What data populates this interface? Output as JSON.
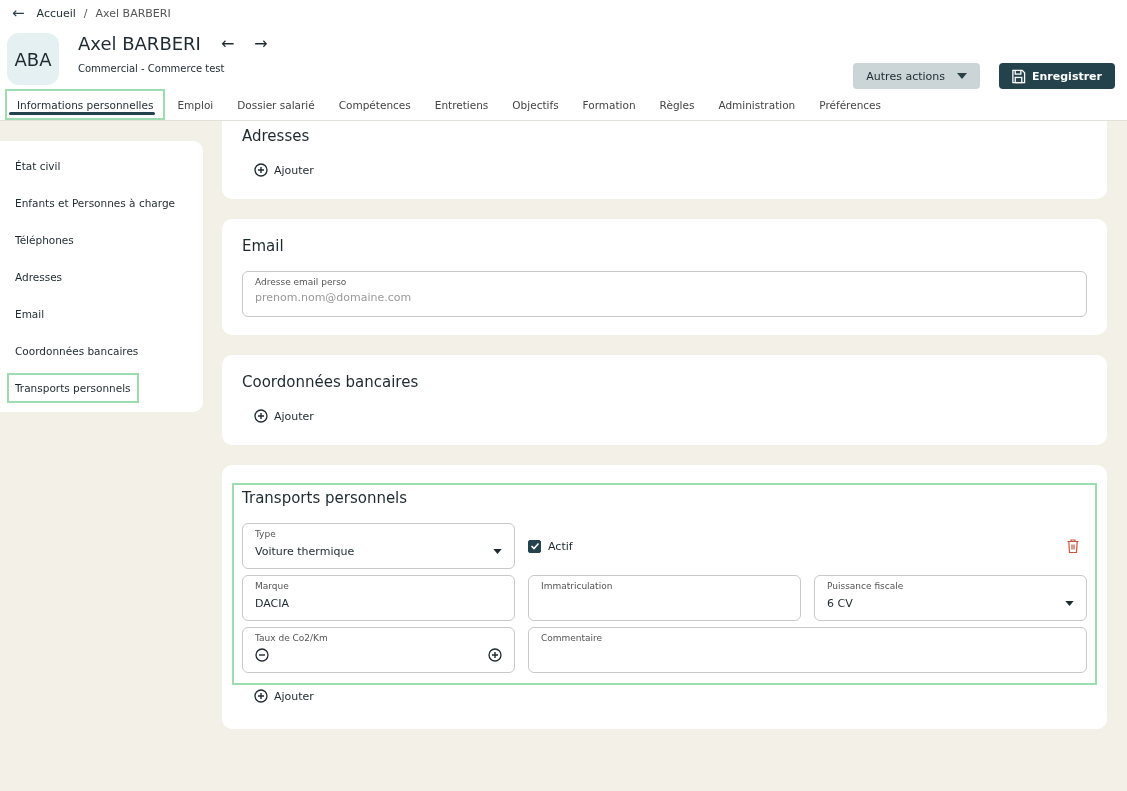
{
  "breadcrumb": {
    "back": "←",
    "items": [
      "Accueil",
      "Axel BARBERI"
    ],
    "separator": "/"
  },
  "header": {
    "avatar": "ABA",
    "name": "Axel BARBERI",
    "prev": "←",
    "next": "→",
    "subtitle": "Commercial - Commerce test",
    "actions_button": "Autres actions",
    "save_button": "Enregistrer"
  },
  "tabs": [
    {
      "label": "Informations personnelles",
      "selected": true
    },
    {
      "label": "Emploi",
      "selected": false
    },
    {
      "label": "Dossier salarié",
      "selected": false
    },
    {
      "label": "Compétences",
      "selected": false
    },
    {
      "label": "Entretiens",
      "selected": false
    },
    {
      "label": "Objectifs",
      "selected": false
    },
    {
      "label": "Formation",
      "selected": false
    },
    {
      "label": "Règles",
      "selected": false
    },
    {
      "label": "Administration",
      "selected": false
    },
    {
      "label": "Préférences",
      "selected": false
    }
  ],
  "sidebar": {
    "items": [
      {
        "label": "État civil",
        "selected": false
      },
      {
        "label": "Enfants et Personnes à charge",
        "selected": false
      },
      {
        "label": "Téléphones",
        "selected": false
      },
      {
        "label": "Adresses",
        "selected": false
      },
      {
        "label": "Email",
        "selected": false
      },
      {
        "label": "Coordonnées bancaires",
        "selected": false
      },
      {
        "label": "Transports personnels",
        "selected": true
      }
    ]
  },
  "sections": [
    {
      "kind": "add",
      "title": "Adresses",
      "add": "Ajouter",
      "highlighted": false
    },
    {
      "kind": "email",
      "title": "Email",
      "field": {
        "label": "Adresse email perso",
        "placeholder": "prenom.nom@domaine.com"
      },
      "highlighted": false
    },
    {
      "kind": "add",
      "title": "Coordonnées bancaires",
      "add": "Ajouter",
      "highlighted": false
    },
    {
      "kind": "transport",
      "title": "Transports personnels",
      "highlighted": true,
      "add": "Ajouter",
      "type_field": {
        "label": "Type",
        "value": "Voiture thermique"
      },
      "active": {
        "label": "Actif",
        "checked": true
      },
      "fields": [
        {
          "kind": "text",
          "label": "Marque",
          "value": "DACIA"
        },
        {
          "kind": "text",
          "label": "Immatriculation"
        },
        {
          "kind": "select",
          "label": "Puissance fiscale",
          "value": "6 CV"
        },
        {
          "kind": "number",
          "label": "Taux de Co2/Km"
        },
        {
          "kind": "textarea",
          "label": "Commentaire"
        }
      ]
    }
  ]
}
